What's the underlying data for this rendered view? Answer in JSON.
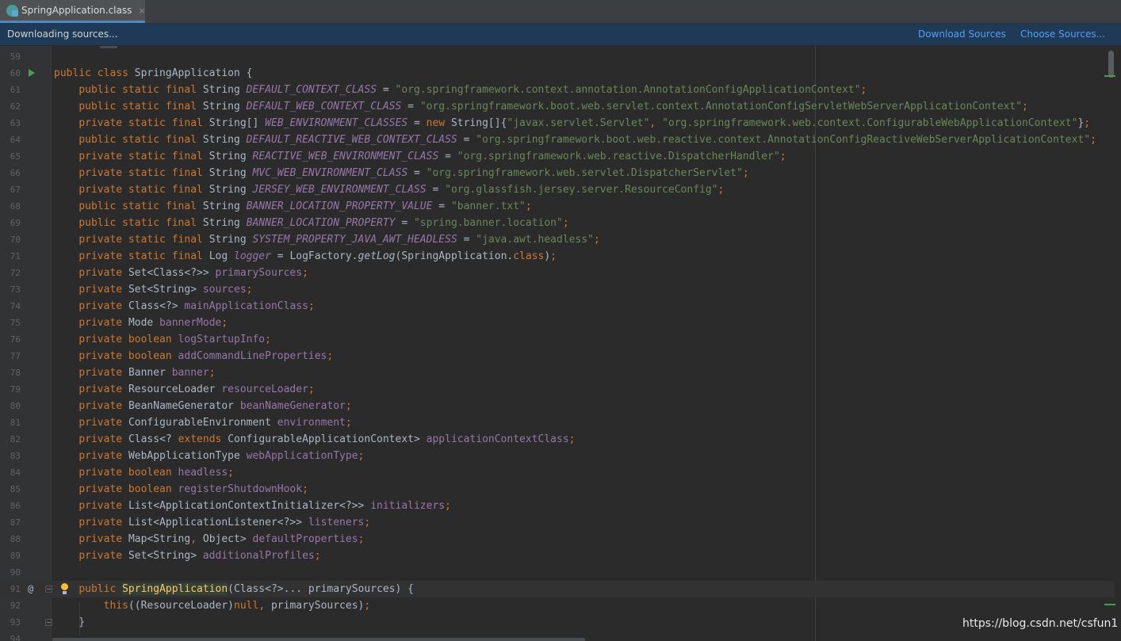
{
  "tab": {
    "icon": "class-file-icon",
    "title": "SpringApplication.class",
    "close": "×"
  },
  "banner": {
    "message": "Downloading sources...",
    "download_sources": "Download Sources",
    "choose_sources": "Choose Sources..."
  },
  "editor": {
    "current_line": 91,
    "lines": [
      {
        "n": "59",
        "segs": []
      },
      {
        "n": "60",
        "segs": [
          [
            "kw",
            "public class "
          ],
          [
            "",
            "SpringApplication {"
          ]
        ]
      },
      {
        "n": "61",
        "segs": [
          [
            "",
            "    "
          ],
          [
            "kw",
            "public static final "
          ],
          [
            "",
            "String "
          ],
          [
            "const",
            "DEFAULT_CONTEXT_CLASS"
          ],
          [
            "",
            " = "
          ],
          [
            "str",
            "\"org.springframework.context.annotation.AnnotationConfigApplicationContext\""
          ],
          [
            "punc",
            ";"
          ]
        ]
      },
      {
        "n": "62",
        "segs": [
          [
            "",
            "    "
          ],
          [
            "kw",
            "public static final "
          ],
          [
            "",
            "String "
          ],
          [
            "const",
            "DEFAULT_WEB_CONTEXT_CLASS"
          ],
          [
            "",
            " = "
          ],
          [
            "str",
            "\"org.springframework.boot.web.servlet.context.AnnotationConfigServletWebServerApplicationContext\""
          ],
          [
            "punc",
            ";"
          ]
        ]
      },
      {
        "n": "63",
        "segs": [
          [
            "",
            "    "
          ],
          [
            "kw",
            "private static final "
          ],
          [
            "",
            "String[] "
          ],
          [
            "const",
            "WEB_ENVIRONMENT_CLASSES"
          ],
          [
            "",
            " = "
          ],
          [
            "kw",
            "new "
          ],
          [
            "",
            "String[]{"
          ],
          [
            "str",
            "\"javax.servlet.Servlet\""
          ],
          [
            "punc",
            ", "
          ],
          [
            "str",
            "\"org.springframework.web.context.ConfigurableWebApplicationContext\""
          ],
          [
            "",
            "}"
          ],
          [
            "punc",
            ";"
          ]
        ]
      },
      {
        "n": "64",
        "segs": [
          [
            "",
            "    "
          ],
          [
            "kw",
            "public static final "
          ],
          [
            "",
            "String "
          ],
          [
            "const",
            "DEFAULT_REACTIVE_WEB_CONTEXT_CLASS"
          ],
          [
            "",
            " = "
          ],
          [
            "str",
            "\"org.springframework.boot.web.reactive.context.AnnotationConfigReactiveWebServerApplicationContext\""
          ],
          [
            "punc",
            ";"
          ]
        ]
      },
      {
        "n": "65",
        "segs": [
          [
            "",
            "    "
          ],
          [
            "kw",
            "private static final "
          ],
          [
            "",
            "String "
          ],
          [
            "const",
            "REACTIVE_WEB_ENVIRONMENT_CLASS"
          ],
          [
            "",
            " = "
          ],
          [
            "str",
            "\"org.springframework.web.reactive.DispatcherHandler\""
          ],
          [
            "punc",
            ";"
          ]
        ]
      },
      {
        "n": "66",
        "segs": [
          [
            "",
            "    "
          ],
          [
            "kw",
            "private static final "
          ],
          [
            "",
            "String "
          ],
          [
            "const",
            "MVC_WEB_ENVIRONMENT_CLASS"
          ],
          [
            "",
            " = "
          ],
          [
            "str",
            "\"org.springframework.web.servlet.DispatcherServlet\""
          ],
          [
            "punc",
            ";"
          ]
        ]
      },
      {
        "n": "67",
        "segs": [
          [
            "",
            "    "
          ],
          [
            "kw",
            "private static final "
          ],
          [
            "",
            "String "
          ],
          [
            "const",
            "JERSEY_WEB_ENVIRONMENT_CLASS"
          ],
          [
            "",
            " = "
          ],
          [
            "str",
            "\"org.glassfish.jersey.server.ResourceConfig\""
          ],
          [
            "punc",
            ";"
          ]
        ]
      },
      {
        "n": "68",
        "segs": [
          [
            "",
            "    "
          ],
          [
            "kw",
            "public static final "
          ],
          [
            "",
            "String "
          ],
          [
            "const",
            "BANNER_LOCATION_PROPERTY_VALUE"
          ],
          [
            "",
            " = "
          ],
          [
            "str",
            "\"banner.txt\""
          ],
          [
            "punc",
            ";"
          ]
        ]
      },
      {
        "n": "69",
        "segs": [
          [
            "",
            "    "
          ],
          [
            "kw",
            "public static final "
          ],
          [
            "",
            "String "
          ],
          [
            "const",
            "BANNER_LOCATION_PROPERTY"
          ],
          [
            "",
            " = "
          ],
          [
            "str",
            "\"spring.banner.location\""
          ],
          [
            "punc",
            ";"
          ]
        ]
      },
      {
        "n": "70",
        "segs": [
          [
            "",
            "    "
          ],
          [
            "kw",
            "private static final "
          ],
          [
            "",
            "String "
          ],
          [
            "const",
            "SYSTEM_PROPERTY_JAVA_AWT_HEADLESS"
          ],
          [
            "",
            " = "
          ],
          [
            "str",
            "\"java.awt.headless\""
          ],
          [
            "punc",
            ";"
          ]
        ]
      },
      {
        "n": "71",
        "segs": [
          [
            "",
            "    "
          ],
          [
            "kw",
            "private static final "
          ],
          [
            "",
            "Log "
          ],
          [
            "const",
            "logger"
          ],
          [
            "",
            " = LogFactory."
          ],
          [
            "method-i",
            "getLog"
          ],
          [
            "",
            "(SpringApplication."
          ],
          [
            "kw",
            "class"
          ],
          [
            "",
            ")"
          ],
          [
            "punc",
            ";"
          ]
        ]
      },
      {
        "n": "72",
        "segs": [
          [
            "",
            "    "
          ],
          [
            "kw",
            "private "
          ],
          [
            "",
            "Set<Class<?>> "
          ],
          [
            "field",
            "primarySources"
          ],
          [
            "punc",
            ";"
          ]
        ]
      },
      {
        "n": "73",
        "segs": [
          [
            "",
            "    "
          ],
          [
            "kw",
            "private "
          ],
          [
            "",
            "Set<String> "
          ],
          [
            "field",
            "sources"
          ],
          [
            "punc",
            ";"
          ]
        ]
      },
      {
        "n": "74",
        "segs": [
          [
            "",
            "    "
          ],
          [
            "kw",
            "private "
          ],
          [
            "",
            "Class<?> "
          ],
          [
            "field",
            "mainApplicationClass"
          ],
          [
            "punc",
            ";"
          ]
        ]
      },
      {
        "n": "75",
        "segs": [
          [
            "",
            "    "
          ],
          [
            "kw",
            "private "
          ],
          [
            "",
            "Mode "
          ],
          [
            "field",
            "bannerMode"
          ],
          [
            "punc",
            ";"
          ]
        ]
      },
      {
        "n": "76",
        "segs": [
          [
            "",
            "    "
          ],
          [
            "kw",
            "private boolean "
          ],
          [
            "field",
            "logStartupInfo"
          ],
          [
            "punc",
            ";"
          ]
        ]
      },
      {
        "n": "77",
        "segs": [
          [
            "",
            "    "
          ],
          [
            "kw",
            "private boolean "
          ],
          [
            "field",
            "addCommandLineProperties"
          ],
          [
            "punc",
            ";"
          ]
        ]
      },
      {
        "n": "78",
        "segs": [
          [
            "",
            "    "
          ],
          [
            "kw",
            "private "
          ],
          [
            "",
            "Banner "
          ],
          [
            "field",
            "banner"
          ],
          [
            "punc",
            ";"
          ]
        ]
      },
      {
        "n": "79",
        "segs": [
          [
            "",
            "    "
          ],
          [
            "kw",
            "private "
          ],
          [
            "",
            "ResourceLoader "
          ],
          [
            "field",
            "resourceLoader"
          ],
          [
            "punc",
            ";"
          ]
        ]
      },
      {
        "n": "80",
        "segs": [
          [
            "",
            "    "
          ],
          [
            "kw",
            "private "
          ],
          [
            "",
            "BeanNameGenerator "
          ],
          [
            "field",
            "beanNameGenerator"
          ],
          [
            "punc",
            ";"
          ]
        ]
      },
      {
        "n": "81",
        "segs": [
          [
            "",
            "    "
          ],
          [
            "kw",
            "private "
          ],
          [
            "",
            "ConfigurableEnvironment "
          ],
          [
            "field",
            "environment"
          ],
          [
            "punc",
            ";"
          ]
        ]
      },
      {
        "n": "82",
        "segs": [
          [
            "",
            "    "
          ],
          [
            "kw",
            "private "
          ],
          [
            "",
            "Class<? "
          ],
          [
            "kw",
            "extends "
          ],
          [
            "",
            "ConfigurableApplicationContext> "
          ],
          [
            "field",
            "applicationContextClass"
          ],
          [
            "punc",
            ";"
          ]
        ]
      },
      {
        "n": "83",
        "segs": [
          [
            "",
            "    "
          ],
          [
            "kw",
            "private "
          ],
          [
            "",
            "WebApplicationType "
          ],
          [
            "field",
            "webApplicationType"
          ],
          [
            "punc",
            ";"
          ]
        ]
      },
      {
        "n": "84",
        "segs": [
          [
            "",
            "    "
          ],
          [
            "kw",
            "private boolean "
          ],
          [
            "field",
            "headless"
          ],
          [
            "punc",
            ";"
          ]
        ]
      },
      {
        "n": "85",
        "segs": [
          [
            "",
            "    "
          ],
          [
            "kw",
            "private boolean "
          ],
          [
            "field",
            "registerShutdownHook"
          ],
          [
            "punc",
            ";"
          ]
        ]
      },
      {
        "n": "86",
        "segs": [
          [
            "",
            "    "
          ],
          [
            "kw",
            "private "
          ],
          [
            "",
            "List<ApplicationContextInitializer<?>> "
          ],
          [
            "field",
            "initializers"
          ],
          [
            "punc",
            ";"
          ]
        ]
      },
      {
        "n": "87",
        "segs": [
          [
            "",
            "    "
          ],
          [
            "kw",
            "private "
          ],
          [
            "",
            "List<ApplicationListener<?>> "
          ],
          [
            "field",
            "listeners"
          ],
          [
            "punc",
            ";"
          ]
        ]
      },
      {
        "n": "88",
        "segs": [
          [
            "",
            "    "
          ],
          [
            "kw",
            "private "
          ],
          [
            "",
            "Map<String"
          ],
          [
            "punc",
            ", "
          ],
          [
            "",
            "Object> "
          ],
          [
            "field",
            "defaultProperties"
          ],
          [
            "punc",
            ";"
          ]
        ]
      },
      {
        "n": "89",
        "segs": [
          [
            "",
            "    "
          ],
          [
            "kw",
            "private "
          ],
          [
            "",
            "Set<String> "
          ],
          [
            "field",
            "additionalProfiles"
          ],
          [
            "punc",
            ";"
          ]
        ]
      },
      {
        "n": "90",
        "segs": []
      },
      {
        "n": "91",
        "segs": [
          [
            "",
            "    "
          ],
          [
            "kw",
            "public "
          ],
          [
            "ctor caret-word",
            "SpringApplication"
          ],
          [
            "",
            "(Class<?>... primarySources) {"
          ]
        ]
      },
      {
        "n": "92",
        "segs": [
          [
            "",
            "        "
          ],
          [
            "kw",
            "this"
          ],
          [
            "",
            "((ResourceLoader)"
          ],
          [
            "kw",
            "null"
          ],
          [
            "punc",
            ", "
          ],
          [
            "",
            "primarySources)"
          ],
          [
            "punc",
            ";"
          ]
        ]
      },
      {
        "n": "93",
        "segs": [
          [
            "",
            "    }"
          ]
        ]
      },
      {
        "n": "94",
        "segs": []
      }
    ]
  },
  "gutter_icons": {
    "run": "run-icon",
    "override": "@",
    "bulb": "intention-bulb-icon",
    "fold": "fold-icon"
  },
  "watermark": "https://blog.csdn.net/csfun1",
  "colors": {
    "background": "#2b2b2b",
    "keyword": "#cc7832",
    "string": "#6a8759",
    "field": "#9876aa",
    "accent": "#4a88c7"
  }
}
